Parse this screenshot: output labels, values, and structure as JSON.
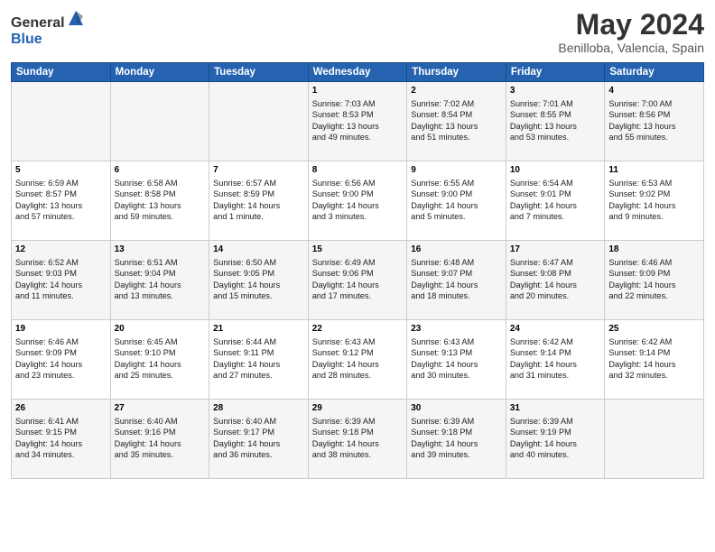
{
  "header": {
    "logo_general": "General",
    "logo_blue": "Blue",
    "month": "May 2024",
    "location": "Benilloba, Valencia, Spain"
  },
  "weekdays": [
    "Sunday",
    "Monday",
    "Tuesday",
    "Wednesday",
    "Thursday",
    "Friday",
    "Saturday"
  ],
  "weeks": [
    [
      {
        "day": "",
        "info": ""
      },
      {
        "day": "",
        "info": ""
      },
      {
        "day": "",
        "info": ""
      },
      {
        "day": "1",
        "info": "Sunrise: 7:03 AM\nSunset: 8:53 PM\nDaylight: 13 hours\nand 49 minutes."
      },
      {
        "day": "2",
        "info": "Sunrise: 7:02 AM\nSunset: 8:54 PM\nDaylight: 13 hours\nand 51 minutes."
      },
      {
        "day": "3",
        "info": "Sunrise: 7:01 AM\nSunset: 8:55 PM\nDaylight: 13 hours\nand 53 minutes."
      },
      {
        "day": "4",
        "info": "Sunrise: 7:00 AM\nSunset: 8:56 PM\nDaylight: 13 hours\nand 55 minutes."
      }
    ],
    [
      {
        "day": "5",
        "info": "Sunrise: 6:59 AM\nSunset: 8:57 PM\nDaylight: 13 hours\nand 57 minutes."
      },
      {
        "day": "6",
        "info": "Sunrise: 6:58 AM\nSunset: 8:58 PM\nDaylight: 13 hours\nand 59 minutes."
      },
      {
        "day": "7",
        "info": "Sunrise: 6:57 AM\nSunset: 8:59 PM\nDaylight: 14 hours\nand 1 minute."
      },
      {
        "day": "8",
        "info": "Sunrise: 6:56 AM\nSunset: 9:00 PM\nDaylight: 14 hours\nand 3 minutes."
      },
      {
        "day": "9",
        "info": "Sunrise: 6:55 AM\nSunset: 9:00 PM\nDaylight: 14 hours\nand 5 minutes."
      },
      {
        "day": "10",
        "info": "Sunrise: 6:54 AM\nSunset: 9:01 PM\nDaylight: 14 hours\nand 7 minutes."
      },
      {
        "day": "11",
        "info": "Sunrise: 6:53 AM\nSunset: 9:02 PM\nDaylight: 14 hours\nand 9 minutes."
      }
    ],
    [
      {
        "day": "12",
        "info": "Sunrise: 6:52 AM\nSunset: 9:03 PM\nDaylight: 14 hours\nand 11 minutes."
      },
      {
        "day": "13",
        "info": "Sunrise: 6:51 AM\nSunset: 9:04 PM\nDaylight: 14 hours\nand 13 minutes."
      },
      {
        "day": "14",
        "info": "Sunrise: 6:50 AM\nSunset: 9:05 PM\nDaylight: 14 hours\nand 15 minutes."
      },
      {
        "day": "15",
        "info": "Sunrise: 6:49 AM\nSunset: 9:06 PM\nDaylight: 14 hours\nand 17 minutes."
      },
      {
        "day": "16",
        "info": "Sunrise: 6:48 AM\nSunset: 9:07 PM\nDaylight: 14 hours\nand 18 minutes."
      },
      {
        "day": "17",
        "info": "Sunrise: 6:47 AM\nSunset: 9:08 PM\nDaylight: 14 hours\nand 20 minutes."
      },
      {
        "day": "18",
        "info": "Sunrise: 6:46 AM\nSunset: 9:09 PM\nDaylight: 14 hours\nand 22 minutes."
      }
    ],
    [
      {
        "day": "19",
        "info": "Sunrise: 6:46 AM\nSunset: 9:09 PM\nDaylight: 14 hours\nand 23 minutes."
      },
      {
        "day": "20",
        "info": "Sunrise: 6:45 AM\nSunset: 9:10 PM\nDaylight: 14 hours\nand 25 minutes."
      },
      {
        "day": "21",
        "info": "Sunrise: 6:44 AM\nSunset: 9:11 PM\nDaylight: 14 hours\nand 27 minutes."
      },
      {
        "day": "22",
        "info": "Sunrise: 6:43 AM\nSunset: 9:12 PM\nDaylight: 14 hours\nand 28 minutes."
      },
      {
        "day": "23",
        "info": "Sunrise: 6:43 AM\nSunset: 9:13 PM\nDaylight: 14 hours\nand 30 minutes."
      },
      {
        "day": "24",
        "info": "Sunrise: 6:42 AM\nSunset: 9:14 PM\nDaylight: 14 hours\nand 31 minutes."
      },
      {
        "day": "25",
        "info": "Sunrise: 6:42 AM\nSunset: 9:14 PM\nDaylight: 14 hours\nand 32 minutes."
      }
    ],
    [
      {
        "day": "26",
        "info": "Sunrise: 6:41 AM\nSunset: 9:15 PM\nDaylight: 14 hours\nand 34 minutes."
      },
      {
        "day": "27",
        "info": "Sunrise: 6:40 AM\nSunset: 9:16 PM\nDaylight: 14 hours\nand 35 minutes."
      },
      {
        "day": "28",
        "info": "Sunrise: 6:40 AM\nSunset: 9:17 PM\nDaylight: 14 hours\nand 36 minutes."
      },
      {
        "day": "29",
        "info": "Sunrise: 6:39 AM\nSunset: 9:18 PM\nDaylight: 14 hours\nand 38 minutes."
      },
      {
        "day": "30",
        "info": "Sunrise: 6:39 AM\nSunset: 9:18 PM\nDaylight: 14 hours\nand 39 minutes."
      },
      {
        "day": "31",
        "info": "Sunrise: 6:39 AM\nSunset: 9:19 PM\nDaylight: 14 hours\nand 40 minutes."
      },
      {
        "day": "",
        "info": ""
      }
    ]
  ]
}
